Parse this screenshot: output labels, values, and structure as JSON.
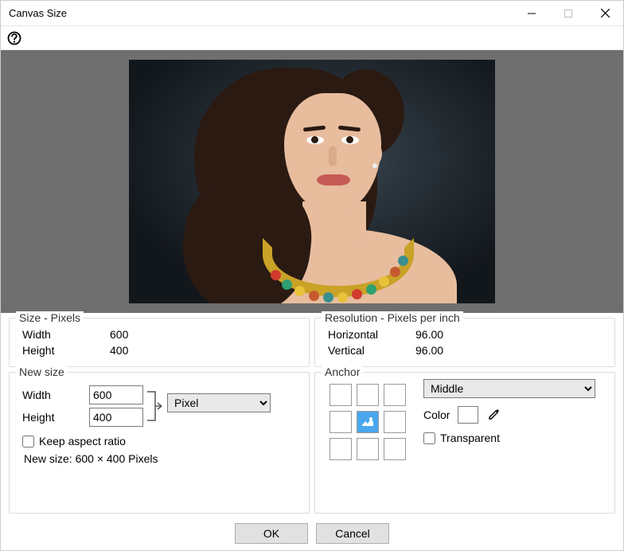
{
  "window": {
    "title": "Canvas Size"
  },
  "size_panel": {
    "legend": "Size - Pixels",
    "width_label": "Width",
    "width_value": "600",
    "height_label": "Height",
    "height_value": "400"
  },
  "resolution_panel": {
    "legend": "Resolution - Pixels per inch",
    "horiz_label": "Horizontal",
    "horiz_value": "96.00",
    "vert_label": "Vertical",
    "vert_value": "96.00"
  },
  "newsize_panel": {
    "legend": "New size",
    "width_label": "Width",
    "width_value": "600",
    "height_label": "Height",
    "height_value": "400",
    "unit_selected": "Pixel",
    "keep_aspect_label": "Keep aspect ratio",
    "keep_aspect_checked": false,
    "summary": "New size: 600 × 400 Pixels"
  },
  "anchor_panel": {
    "legend": "Anchor",
    "position_selected": "Middle",
    "color_label": "Color",
    "color_value": "#ffffff",
    "transparent_label": "Transparent",
    "transparent_checked": false
  },
  "buttons": {
    "ok": "OK",
    "cancel": "Cancel"
  }
}
